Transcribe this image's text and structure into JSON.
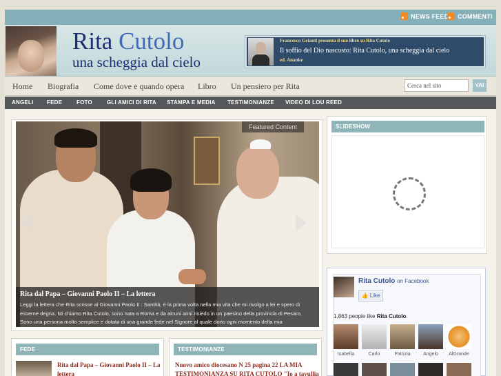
{
  "topbar": {
    "news_feed": "NEWS FEED",
    "comments": "COMMENTI"
  },
  "header": {
    "title_first": "Rita",
    "title_last": "Cutolo",
    "subtitle": "una scheggia dal cielo",
    "promo": {
      "small": "Francesco Grianti presenta il suo libro su Rita Cutolo",
      "big": "Il soffio del Dio nascosto: Rita Cutolo, una scheggia dal cielo",
      "publisher": "ed. Ananke"
    }
  },
  "main_nav": [
    "Home",
    "Biografia",
    "Come dove e quando opera",
    "Libro",
    "Un pensiero per Rita"
  ],
  "search": {
    "placeholder": "Cerca nel sito",
    "button": "VAI"
  },
  "sub_nav": [
    "ANGELI",
    "FEDE",
    "FOTO",
    "GLI AMICI DI RITA",
    "STAMPA E MEDIA",
    "TESTIMONIANZE",
    "VIDEO DI LOU REED"
  ],
  "featured": {
    "label": "Featured Content",
    "title": "Rita dal Papa – Giovanni Paolo II – La lettera",
    "text": "Leggi la lettera che Rita scrisse al Giovanni Paolo II : Santità, è la prima volta nella mia vita che mi rivolgo a lei e spero di esserne degna. Mi chiamo Rita Cutolo, sono nata a Roma e da alcuni anni risiedo in un paesino della provincia di Pesaro. Sono una persona molto semplice e dotata di una grande fede nel Signore al quale dono ogni momento della mia"
  },
  "slideshow": {
    "heading": "SLIDESHOW"
  },
  "facebook": {
    "page": "Rita Cutolo",
    "on": "on Facebook",
    "like": "Like",
    "count_text": "1,863 people like",
    "count_page": "Rita Cutolo",
    "fans": [
      "Isabella",
      "Carlo",
      "Patrizia",
      "Angelo",
      "AlGrande"
    ]
  },
  "fede": {
    "heading": "FEDE",
    "post_title": "Rita dal Papa – Giovanni Paolo II – La lettera"
  },
  "testimonianze": {
    "heading": "TESTIMONIANZE",
    "post_title": "Nuovo amico diocesano N 25 pagina 22 LA MIA TESTIMONIANZA SU RITA CUTOLO \"Io a tavullia"
  }
}
